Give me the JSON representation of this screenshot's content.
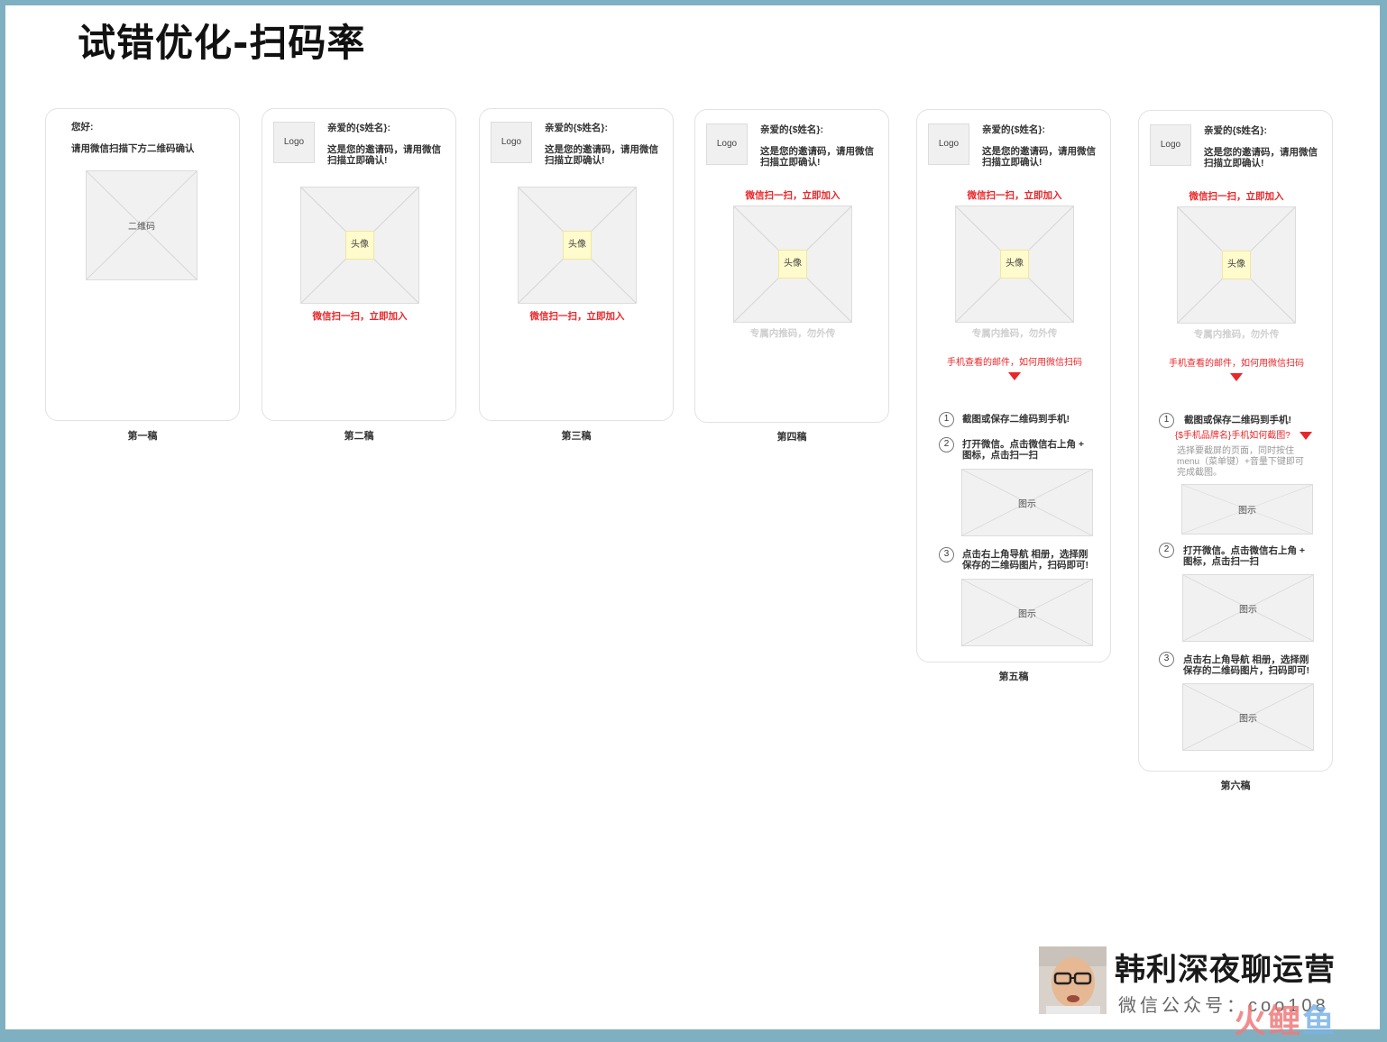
{
  "title": "试错优化-扫码率",
  "common": {
    "logo": "Logo",
    "greeting": "亲爱的{$姓名}:",
    "invite_line1": "这是您的邀请码，请用微信",
    "invite_line2": "扫描立即确认!",
    "avatar": "头像",
    "cta": "微信扫一扫，立即加入",
    "exclusive": "专属内推码，勿外传",
    "mobile_tip": "手机查看的邮件，如何用微信扫码",
    "step1": "截图或保存二维码到手机!",
    "step2_line1": "打开微信。点击微信右上角 +",
    "step2_line2": "图标，点击扫一扫",
    "step3_line1": "点击右上角导航 相册，选择刚",
    "step3_line2": "保存的二维码图片，扫码即可!",
    "figure": "图示"
  },
  "draft1": {
    "hello": "您好:",
    "instruction": "请用微信扫描下方二维码确认",
    "qr": "二维码",
    "caption": "第一稿"
  },
  "draft2": {
    "caption": "第二稿"
  },
  "draft3": {
    "caption": "第三稿"
  },
  "draft4": {
    "caption": "第四稿"
  },
  "draft5": {
    "caption": "第五稿"
  },
  "draft6": {
    "caption": "第六稿",
    "screenshot_q": "{$手机品牌名}手机如何截图?",
    "hint_line1": "选择要截屏的页面，同时按住",
    "hint_line2": "menu（菜单键）+音量下键即可",
    "hint_line3": "完成截图。"
  },
  "brand": {
    "name": "韩利深夜聊运营",
    "sub": "微信公众号：coo108",
    "wm1": "火",
    "wm2": "鲤",
    "wm3": "鱼"
  },
  "colors": {
    "accent_red": "#e8272a",
    "frame": "#7fb0c2"
  }
}
